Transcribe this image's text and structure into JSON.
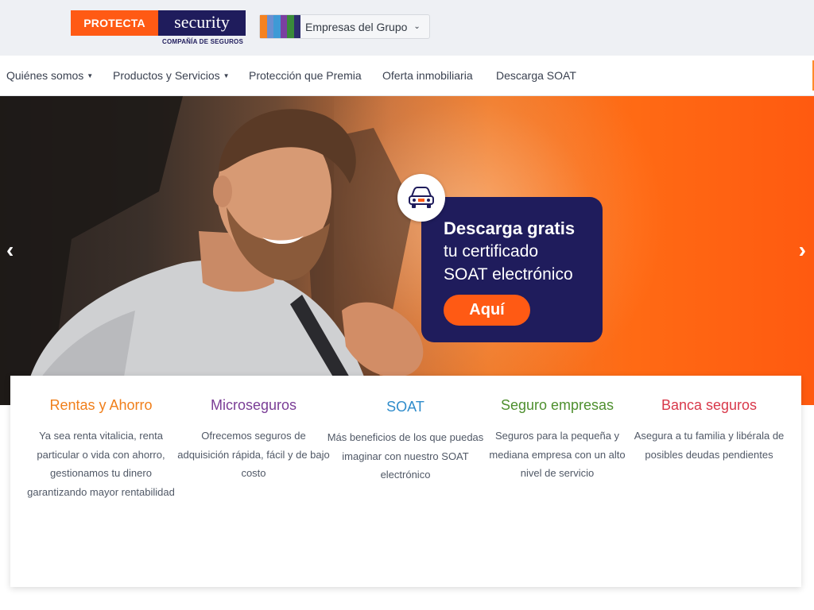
{
  "header": {
    "logo": {
      "left_text": "PROTECTA",
      "right_text": "security",
      "subtitle": "COMPAÑÍA DE SEGUROS"
    },
    "group_button": {
      "label": "Empresas del Grupo",
      "stripe_colors": [
        "#f58220",
        "#6a8fd0",
        "#3e9ad6",
        "#7b3fa0",
        "#3a8a3a",
        "#2d2d6e"
      ]
    }
  },
  "nav": {
    "items": [
      {
        "label": "Quiénes somos",
        "has_dropdown": true
      },
      {
        "label": "Productos y Servicios",
        "has_dropdown": true
      },
      {
        "label": "Protección que Premia",
        "has_dropdown": false
      },
      {
        "label": "Oferta inmobiliaria",
        "has_dropdown": false
      },
      {
        "label": "Descarga SOAT",
        "has_dropdown": false
      }
    ]
  },
  "hero": {
    "prev_arrow": "‹",
    "next_arrow": "›",
    "promo": {
      "icon": "car-icon",
      "line1": "Descarga gratis",
      "line2": "tu certificado",
      "line3": "SOAT electrónico",
      "button": "Aquí"
    }
  },
  "cards": [
    {
      "title": "Rentas y Ahorro",
      "color": "#f07f1b",
      "text": "Ya sea renta vitalicia, renta particular o vida con ahorro, gestionamos tu dinero garantizando mayor rentabilidad"
    },
    {
      "title": "Microseguros",
      "color": "#7a3d96",
      "text": "Ofrecemos seguros de adquisición rápida, fácil y de bajo costo"
    },
    {
      "title": "SOAT",
      "color": "#2f8ccb",
      "text": "Más beneficios de los que puedas imaginar con nuestro SOAT electrónico"
    },
    {
      "title": "Seguro empresas",
      "color": "#4e8f2e",
      "text": "Seguros para la pequeña y mediana empresa con un alto nivel de servicio"
    },
    {
      "title": "Banca seguros",
      "color": "#d8384a",
      "text": "Asegura a tu familia y libérala de posibles deudas pendientes"
    }
  ],
  "colors": {
    "brand_orange": "#ff5a14",
    "brand_navy": "#1f1c5c"
  }
}
